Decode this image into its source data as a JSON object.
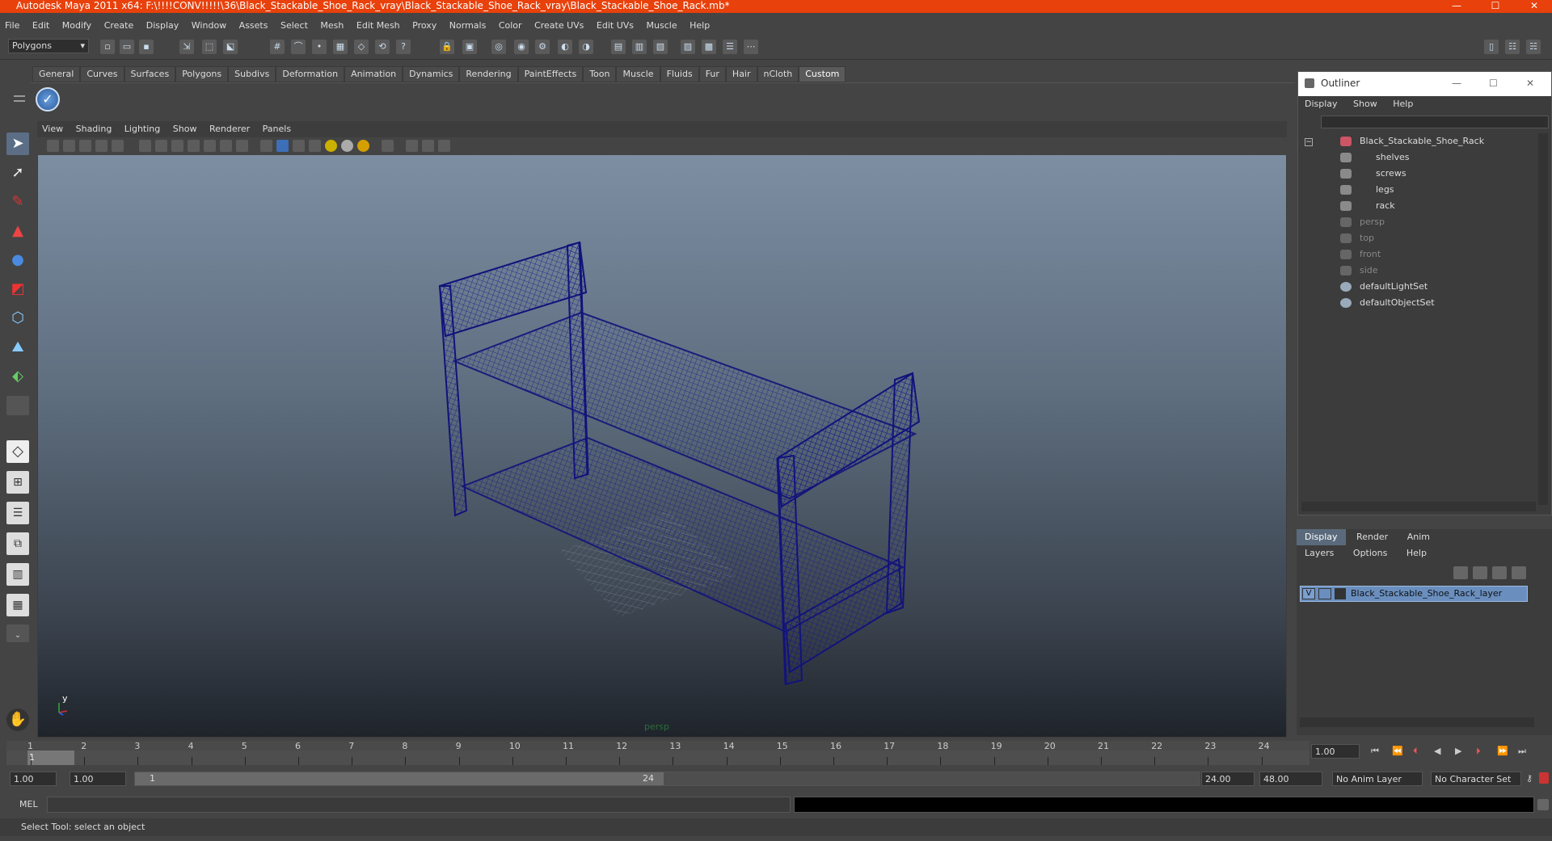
{
  "window": {
    "title": "Autodesk Maya 2011 x64: F:\\!!!!CONV!!!!!\\36\\Black_Stackable_Shoe_Rack_vray\\Black_Stackable_Shoe_Rack_vray\\Black_Stackable_Shoe_Rack.mb*",
    "minimize": "—",
    "maximize": "☐",
    "close": "✕"
  },
  "menubar": [
    "File",
    "Edit",
    "Modify",
    "Create",
    "Display",
    "Window",
    "Assets",
    "Select",
    "Mesh",
    "Edit Mesh",
    "Proxy",
    "Normals",
    "Color",
    "Create UVs",
    "Edit UVs",
    "Muscle",
    "Help"
  ],
  "statusline": {
    "menuset": "Polygons"
  },
  "shelf": {
    "tabs": [
      "General",
      "Curves",
      "Surfaces",
      "Polygons",
      "Subdivs",
      "Deformation",
      "Animation",
      "Dynamics",
      "Rendering",
      "PaintEffects",
      "Toon",
      "Muscle",
      "Fluids",
      "Fur",
      "Hair",
      "nCloth",
      "Custom"
    ],
    "active": "Custom"
  },
  "viewport": {
    "menu": [
      "View",
      "Shading",
      "Lighting",
      "Show",
      "Renderer",
      "Panels"
    ],
    "camera": "persp",
    "axis_y": "y"
  },
  "outliner": {
    "title": "Outliner",
    "menu": [
      "Display",
      "Show",
      "Help"
    ],
    "items": [
      {
        "label": "Black_Stackable_Shoe_Rack",
        "level": 0,
        "dim": false
      },
      {
        "label": "shelves",
        "level": 1,
        "dim": false
      },
      {
        "label": "screws",
        "level": 1,
        "dim": false
      },
      {
        "label": "legs",
        "level": 1,
        "dim": false
      },
      {
        "label": "rack",
        "level": 1,
        "dim": false
      },
      {
        "label": "persp",
        "level": 0,
        "dim": true
      },
      {
        "label": "top",
        "level": 0,
        "dim": true
      },
      {
        "label": "front",
        "level": 0,
        "dim": true
      },
      {
        "label": "side",
        "level": 0,
        "dim": true
      },
      {
        "label": "defaultLightSet",
        "level": 0,
        "dim": false
      },
      {
        "label": "defaultObjectSet",
        "level": 0,
        "dim": false
      }
    ]
  },
  "layers": {
    "tabs": [
      "Display",
      "Render",
      "Anim"
    ],
    "active": "Display",
    "menu": [
      "Layers",
      "Options",
      "Help"
    ],
    "layer": {
      "visible": "V",
      "name": "Black_Stackable_Shoe_Rack_layer"
    }
  },
  "timeline": {
    "ticks": [
      "1",
      "2",
      "3",
      "4",
      "5",
      "6",
      "7",
      "8",
      "9",
      "10",
      "11",
      "12",
      "13",
      "14",
      "15",
      "16",
      "17",
      "18",
      "19",
      "20",
      "21",
      "22",
      "23",
      "24"
    ],
    "current_frame": "1",
    "current_field": "1.00"
  },
  "range": {
    "start": "1.00",
    "playback_start": "1.00",
    "slider_start": "1",
    "slider_end": "24",
    "playback_end": "24.00",
    "end": "48.00",
    "anim_layer": "No Anim Layer",
    "character_set": "No Character Set"
  },
  "command": {
    "label": "MEL"
  },
  "helpline": "Select Tool: select an object"
}
